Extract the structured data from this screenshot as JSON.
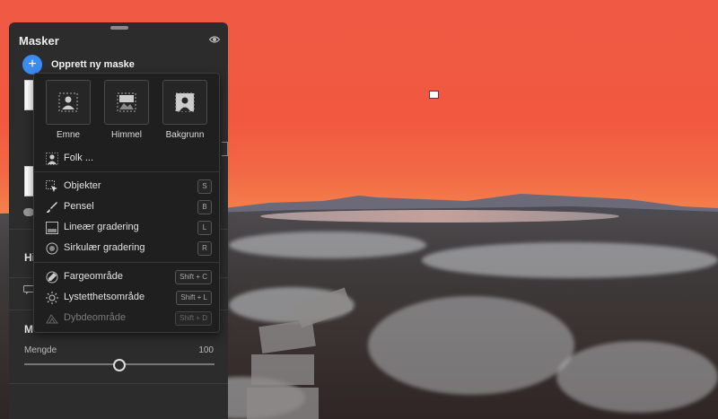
{
  "panel": {
    "title": "Masker",
    "create_label": "Opprett ny maske",
    "section_h": "Hi",
    "section_m": "M",
    "slider_label": "Mengde",
    "slider_value": "100",
    "slider_position": 0.5
  },
  "menu": {
    "tiles": [
      {
        "label": "Emne",
        "icon": "subject-icon"
      },
      {
        "label": "Himmel",
        "icon": "sky-icon"
      },
      {
        "label": "Bakgrunn",
        "icon": "background-icon"
      }
    ],
    "people": {
      "label": "Folk ...",
      "icon": "person-icon"
    },
    "tools": [
      {
        "label": "Objekter",
        "icon": "object-select-icon",
        "key": "S"
      },
      {
        "label": "Pensel",
        "icon": "brush-icon",
        "key": "B"
      },
      {
        "label": "Lineær gradering",
        "icon": "linear-gradient-icon",
        "key": "L"
      },
      {
        "label": "Sirkulær gradering",
        "icon": "radial-gradient-icon",
        "key": "R"
      }
    ],
    "ranges": [
      {
        "label": "Fargeområde",
        "icon": "color-range-icon",
        "key": "Shift + C"
      },
      {
        "label": "Lystetthetsområde",
        "icon": "luminance-range-icon",
        "key": "Shift + L"
      },
      {
        "label": "Dybdeområde",
        "icon": "depth-range-icon",
        "key": "Shift + D",
        "disabled": true
      }
    ]
  },
  "colors": {
    "accent": "#3c8bf0",
    "sky": "#f05a45"
  }
}
